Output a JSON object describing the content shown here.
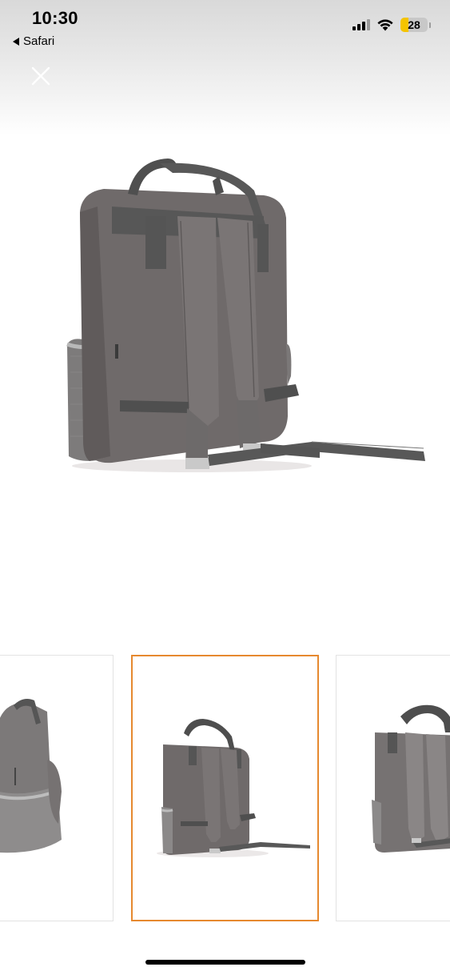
{
  "status_bar": {
    "time": "10:30",
    "back_app": "Safari",
    "battery_level": "28",
    "signal_bars_active": 3,
    "signal_bars_total": 4,
    "icons": [
      "cellular-signal-icon",
      "wifi-icon",
      "battery-icon"
    ]
  },
  "viewer": {
    "close_icon": "close-icon",
    "main_image": "backpack-back-view",
    "thumbnails": [
      {
        "name": "backpack-side-view",
        "active": false
      },
      {
        "name": "backpack-back-view",
        "active": true
      },
      {
        "name": "backpack-back-view-alt",
        "active": false
      }
    ],
    "active_border_color": "#e6892f"
  },
  "colors": {
    "bag_body": "#6f6a6a",
    "bag_dark": "#5c5858",
    "strap": "#7a7575",
    "mesh": "#8a8888"
  }
}
